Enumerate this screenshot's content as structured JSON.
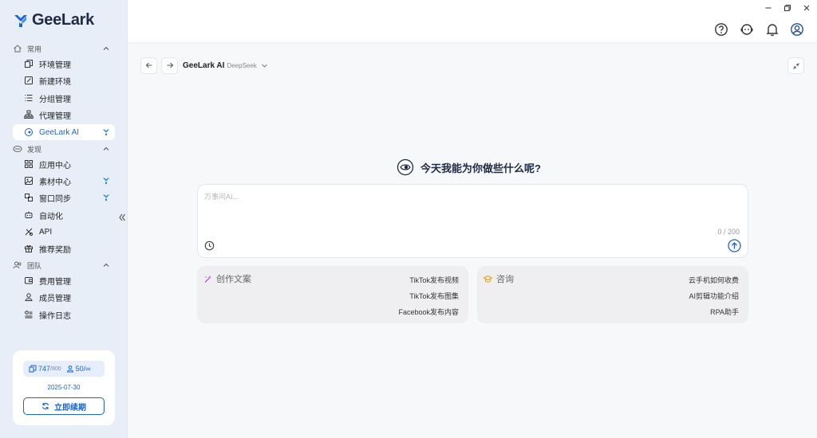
{
  "app": {
    "brand": "GeeLark",
    "accent": "#1a63d8"
  },
  "sidebar": {
    "sections": [
      {
        "label": "常用",
        "items": [
          "环境管理",
          "新建环境",
          "分组管理",
          "代理管理",
          "GeeLark AI"
        ]
      },
      {
        "label": "发现",
        "items": [
          "应用中心",
          "素材中心",
          "窗口同步",
          "自动化",
          "API",
          "推荐奖励"
        ]
      },
      {
        "label": "团队",
        "items": [
          "费用管理",
          "成员管理",
          "操作日志"
        ]
      }
    ],
    "active_item": "GeeLark AI"
  },
  "quota": {
    "devices_used": "747",
    "devices_total": "/800",
    "members": "50/",
    "members_unlimited": "∞",
    "expiry": "2025-07-30",
    "renew_label": "立即续期"
  },
  "toolbar": {
    "title": "GeeLark AI",
    "model": "DeepSeek"
  },
  "main": {
    "greeting": "今天我能为你做些什么呢?",
    "input_placeholder": "万事问AI...",
    "input_value": "",
    "counter": "0 / 200"
  },
  "cards": [
    {
      "title": "创作文案",
      "icon": "magic-wand-icon",
      "links": [
        "TikTok发布视频",
        "TikTok发布图集",
        "Facebook发布内容"
      ]
    },
    {
      "title": "咨询",
      "icon": "graduation-cap-icon",
      "links": [
        "云手机如何收费",
        "AI剪辑功能介绍",
        "RPA助手"
      ]
    }
  ]
}
